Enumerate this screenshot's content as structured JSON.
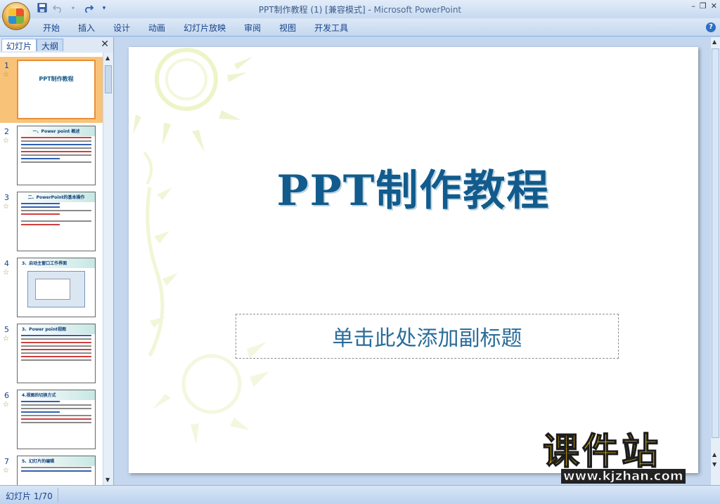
{
  "window": {
    "title": "PPT制作教程 (1) [兼容模式]",
    "app": "Microsoft PowerPoint",
    "separator": " - "
  },
  "quick_access": {
    "save_icon": "save-icon",
    "undo_icon": "undo-icon",
    "redo_icon": "redo-icon",
    "more": "▾"
  },
  "window_controls": {
    "minimize": "–",
    "restore": "❐",
    "close": "✕"
  },
  "ribbon": {
    "tabs": [
      "开始",
      "插入",
      "设计",
      "动画",
      "幻灯片放映",
      "审阅",
      "视图",
      "开发工具"
    ],
    "help": "?"
  },
  "left_panel": {
    "tabs": [
      "幻灯片",
      "大纲"
    ],
    "close": "✕",
    "slides": [
      {
        "number": "1",
        "heading": "PPT制作教程",
        "selected": true
      },
      {
        "number": "2",
        "heading": "一、Power point 概述",
        "selected": false
      },
      {
        "number": "3",
        "heading": "二、PowerPoint的基本操作",
        "selected": false
      },
      {
        "number": "4",
        "heading": "3、启动主窗口工作界面",
        "selected": false
      },
      {
        "number": "5",
        "heading": "3、Power point视图",
        "selected": false
      },
      {
        "number": "6",
        "heading": "4.视图的切换方式",
        "selected": false
      },
      {
        "number": "7",
        "heading": "5、幻灯片的编辑",
        "selected": false
      }
    ],
    "star": "☆"
  },
  "slide": {
    "title": "PPT制作教程",
    "subtitle_placeholder": "单击此处添加副标题"
  },
  "watermark": {
    "brand": "课件站",
    "url": "www.kjzhan.com"
  },
  "status_bar": {
    "slide_counter": "幻灯片 1/70"
  },
  "colors": {
    "title_color": "#125b8c",
    "ribbon_bg": "#c4d8ef",
    "selected_thumb": "#f8c279",
    "watermark_yellow": "#f6c400"
  }
}
